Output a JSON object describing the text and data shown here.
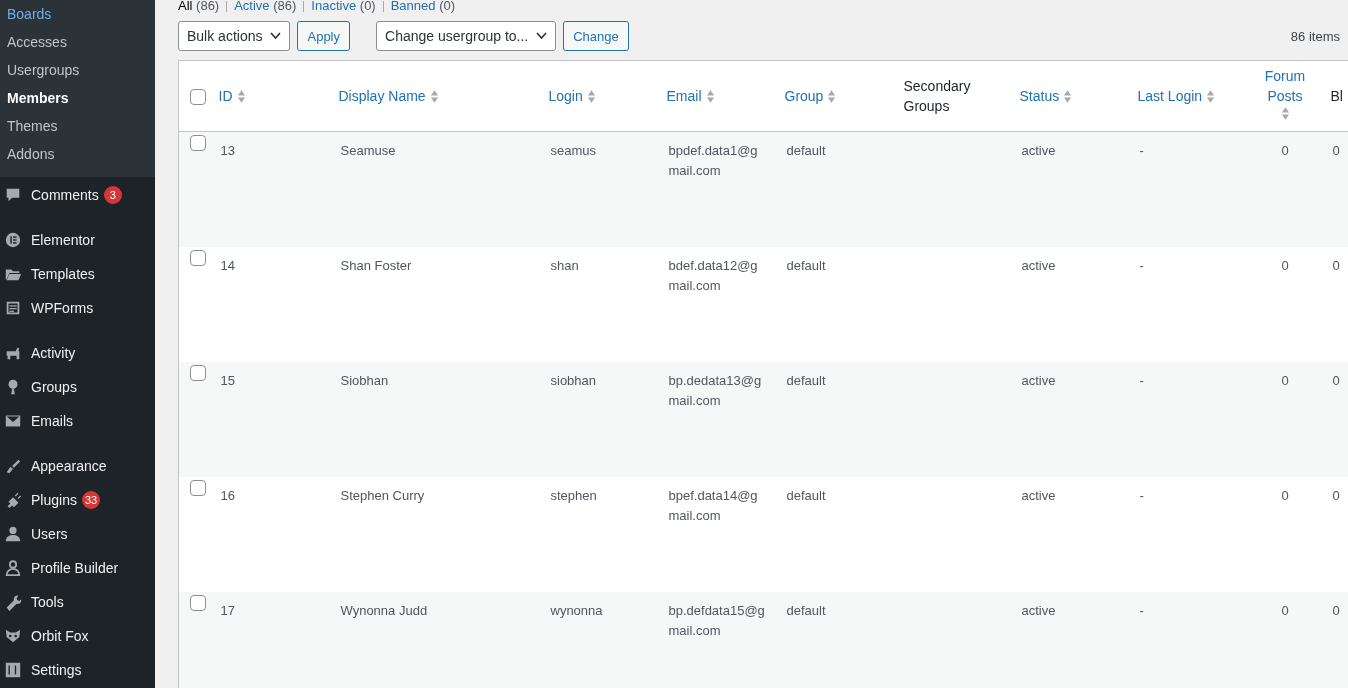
{
  "sidebar": {
    "submenu": [
      {
        "label": "Boards",
        "focused": true,
        "selected": false
      },
      {
        "label": "Accesses",
        "focused": false,
        "selected": false
      },
      {
        "label": "Usergroups",
        "focused": false,
        "selected": false
      },
      {
        "label": "Members",
        "focused": false,
        "selected": true
      },
      {
        "label": "Themes",
        "focused": false,
        "selected": false
      },
      {
        "label": "Addons",
        "focused": false,
        "selected": false
      }
    ],
    "menu_groups": [
      [
        {
          "label": "Comments",
          "badge": "3"
        }
      ],
      [
        {
          "label": "Elementor"
        },
        {
          "label": "Templates"
        },
        {
          "label": "WPForms"
        }
      ],
      [
        {
          "label": "Activity"
        },
        {
          "label": "Groups"
        },
        {
          "label": "Emails"
        }
      ],
      [
        {
          "label": "Appearance"
        },
        {
          "label": "Plugins",
          "badge": "33"
        },
        {
          "label": "Users"
        },
        {
          "label": "Profile Builder"
        },
        {
          "label": "Tools"
        },
        {
          "label": "Orbit Fox"
        },
        {
          "label": "Settings"
        }
      ]
    ]
  },
  "filters": [
    {
      "label": "All",
      "count": "(86)",
      "selected": true
    },
    {
      "label": "Active",
      "count": "(86)",
      "selected": false
    },
    {
      "label": "Inactive",
      "count": "(0)",
      "selected": false
    },
    {
      "label": "Banned",
      "count": "(0)",
      "selected": false
    }
  ],
  "bulk_actions": {
    "value": "Bulk actions"
  },
  "apply_button": "Apply",
  "usergroup_select": {
    "value": "Change usergroup to..."
  },
  "change_button": "Change",
  "item_count": "86 items",
  "table": {
    "select_all": {
      "checked": false
    },
    "columns": [
      {
        "label": "ID",
        "sortable": true
      },
      {
        "label": "Display Name",
        "sortable": true
      },
      {
        "label": "Login",
        "sortable": true
      },
      {
        "label": "Email",
        "sortable": true
      },
      {
        "label": "Group",
        "sortable": true
      },
      {
        "label": "Secondary Groups",
        "sortable": false
      },
      {
        "label": "Status",
        "sortable": true
      },
      {
        "label": "Last Login",
        "sortable": true
      },
      {
        "label": "Forum Posts",
        "sortable": true
      },
      {
        "label": "Bl",
        "sortable": false
      }
    ],
    "rows": [
      {
        "checked": false,
        "id": "13",
        "display_name": "Seamuse",
        "login": "seamus",
        "email": "bpdef.data1@gmail.com",
        "group": "default",
        "status": "active",
        "last_login": "-",
        "forum_posts": "0",
        "column_10": "0"
      },
      {
        "checked": false,
        "id": "14",
        "display_name": "Shan Foster",
        "login": "shan",
        "email": "bdef.data12@gmail.com",
        "group": "default",
        "status": "active",
        "last_login": "-",
        "forum_posts": "0",
        "column_10": "0"
      },
      {
        "checked": false,
        "id": "15",
        "display_name": "Siobhan",
        "login": "siobhan",
        "email": "bp.dedata13@gmail.com",
        "group": "default",
        "status": "active",
        "last_login": "-",
        "forum_posts": "0",
        "column_10": "0"
      },
      {
        "checked": false,
        "id": "16",
        "display_name": "Stephen Curry",
        "login": "stephen",
        "email": "bpef.data14@gmail.com",
        "group": "default",
        "status": "active",
        "last_login": "-",
        "forum_posts": "0",
        "column_10": "0"
      },
      {
        "checked": false,
        "id": "17",
        "display_name": "Wynonna Judd",
        "login": "wynonna",
        "email": "bp.defdata15@gmail.com",
        "group": "default",
        "status": "active",
        "last_login": "-",
        "forum_posts": "0",
        "column_10": "0"
      }
    ]
  }
}
